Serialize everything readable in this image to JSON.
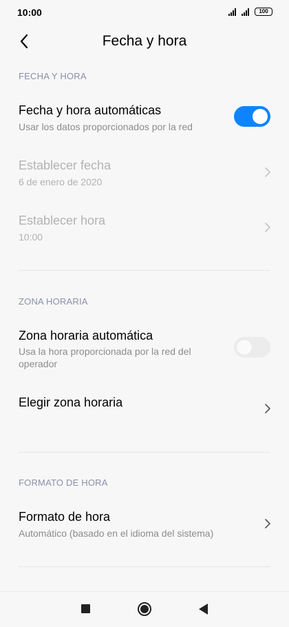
{
  "status_bar": {
    "time": "10:00",
    "battery": "100"
  },
  "header": {
    "title": "Fecha y hora"
  },
  "sections": {
    "date_time": {
      "label": "FECHA Y HORA",
      "auto": {
        "title": "Fecha y hora automáticas",
        "subtitle": "Usar los datos proporcionados por la red",
        "enabled": true
      },
      "set_date": {
        "title": "Establecer fecha",
        "value": "6 de enero de 2020"
      },
      "set_time": {
        "title": "Establecer hora",
        "value": "10:00"
      }
    },
    "time_zone": {
      "label": "ZONA HORARIA",
      "auto": {
        "title": "Zona horaria automática",
        "subtitle": "Usa la hora proporcionada por la red del operador",
        "enabled": false
      },
      "choose": {
        "title": "Elegir zona horaria"
      }
    },
    "time_format": {
      "label": "FORMATO DE HORA",
      "format": {
        "title": "Formato de hora",
        "value": "Automático (basado en el idioma del sistema)"
      }
    }
  },
  "colors": {
    "accent": "#0d84ff",
    "section_label": "#8a8fa8",
    "disabled_text": "#b3b3b3"
  }
}
